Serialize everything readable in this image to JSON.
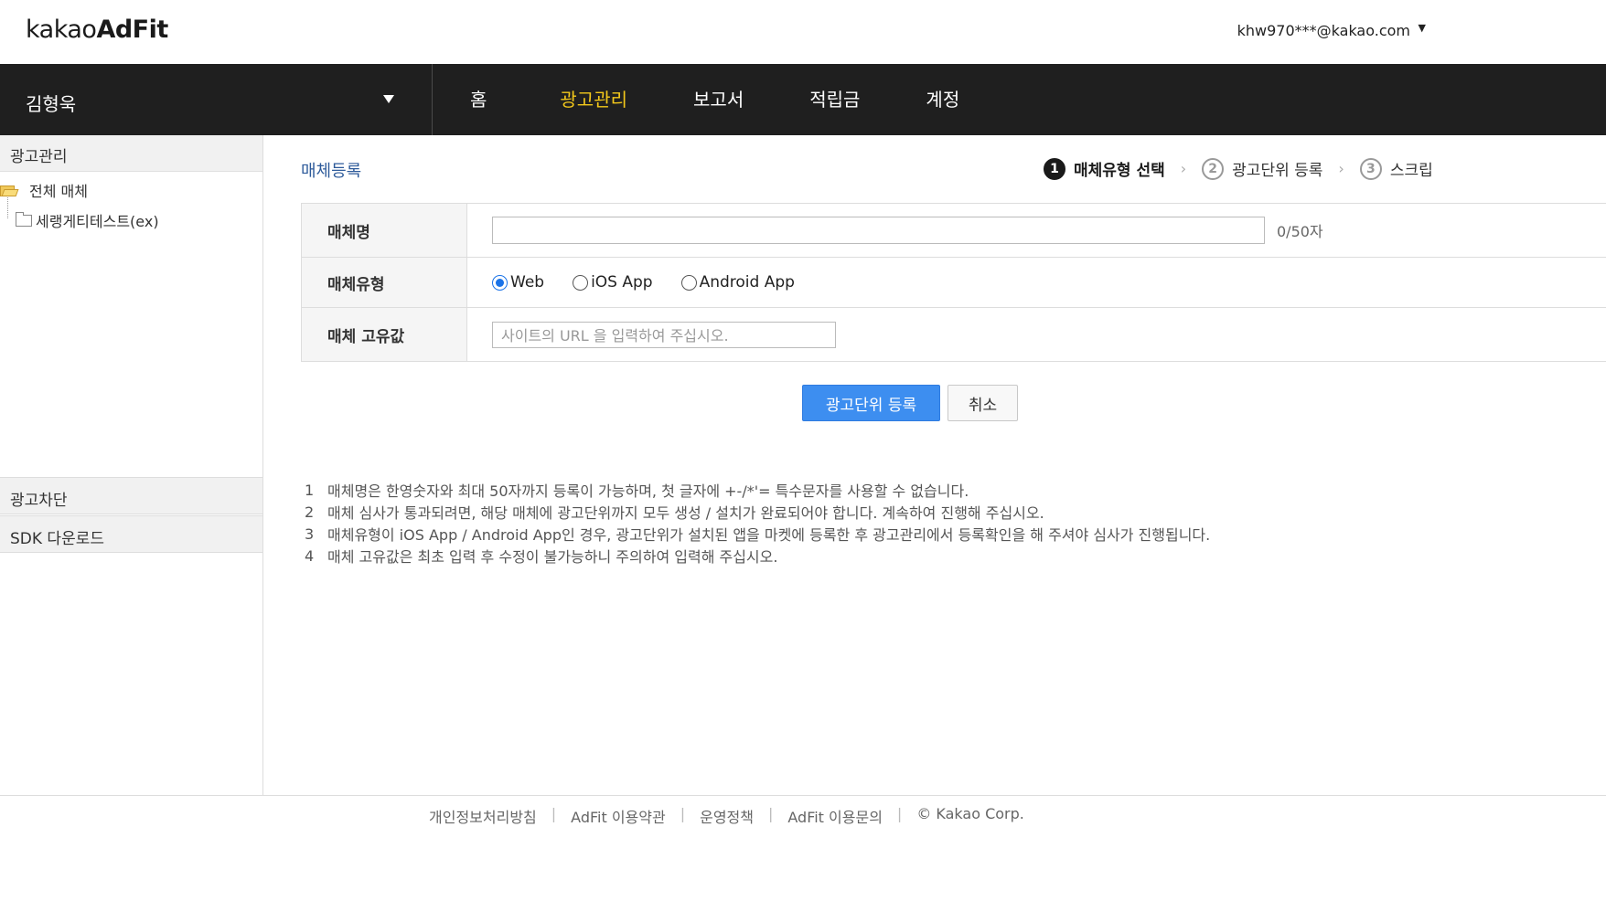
{
  "header": {
    "logo_light": "kakao",
    "logo_bold": "AdFit",
    "account": "khw970***@kakao.com",
    "account_caret": "▼"
  },
  "nav": {
    "user_name": "김형욱",
    "items": [
      {
        "label": "홈"
      },
      {
        "label": "광고관리"
      },
      {
        "label": "보고서"
      },
      {
        "label": "적립금"
      },
      {
        "label": "계정"
      }
    ]
  },
  "sidebar": {
    "heading": "광고관리",
    "tree_root": "전체 매체",
    "tree_child": "세랭게티테스트(ex)",
    "section_block": "광고차단",
    "section_sdk": "SDK 다운로드"
  },
  "main": {
    "title": "매체등록",
    "steps": [
      {
        "num": "1",
        "label": "매체유형 선택"
      },
      {
        "num": "2",
        "label": "광고단위 등록"
      },
      {
        "num": "3",
        "label": "스크립"
      }
    ],
    "step_sep": "›",
    "form": {
      "name_label": "매체명",
      "name_value": "",
      "name_counter": "0/50자",
      "type_label": "매체유형",
      "type_options": [
        "Web",
        "iOS App",
        "Android App"
      ],
      "type_selected": "Web",
      "id_label": "매체 고유값",
      "id_placeholder": "사이트의 URL 을 입력하여 주십시오."
    },
    "buttons": {
      "submit": "광고단위 등록",
      "cancel": "취소"
    },
    "notes": [
      {
        "num": "1",
        "text": "매체명은 한영숫자와 최대 50자까지 등록이 가능하며, 첫 글자에 +-/*'= 특수문자를 사용할 수 없습니다."
      },
      {
        "num": "2",
        "text": "매체 심사가 통과되려면, 해당 매체에 광고단위까지 모두 생성 / 설치가 완료되어야 합니다. 계속하여 진행해 주십시오."
      },
      {
        "num": "3",
        "text": "매체유형이 iOS App / Android App인 경우, 광고단위가 설치된 앱을 마켓에 등록한 후 광고관리에서 등록확인을 해 주셔야 심사가 진행됩니다."
      },
      {
        "num": "4",
        "text": "매체 고유값은 최초 입력 후 수정이 불가능하니 주의하여 입력해 주십시오."
      }
    ]
  },
  "footer": {
    "links": [
      "개인정보처리방침",
      "AdFit 이용약관",
      "운영정책",
      "AdFit 이용문의",
      "© Kakao Corp."
    ],
    "sep": "|"
  },
  "colors": {
    "nav_bg": "#1f1f1f",
    "nav_active": "#f3c81b",
    "title_blue": "#2d5a9a",
    "primary_button": "#3d8ef0"
  }
}
